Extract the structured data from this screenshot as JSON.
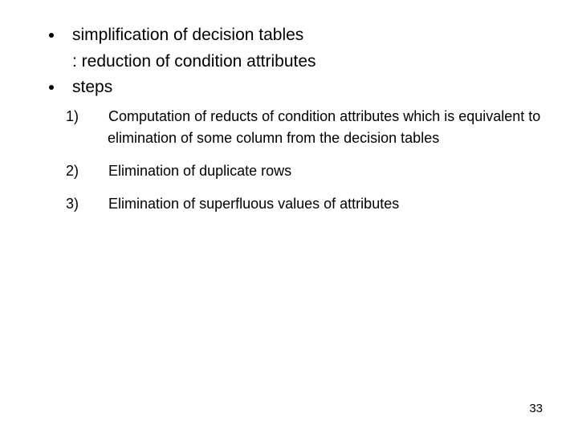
{
  "bullets": [
    {
      "text": "simplification of decision tables",
      "subtext": ": reduction of condition attributes"
    },
    {
      "text": "steps"
    }
  ],
  "steps": [
    {
      "n": "1)",
      "text": "Computation of reducts of condition attributes which is equivalent to elimination of some column from the decision tables"
    },
    {
      "n": "2)",
      "text": "Elimination of duplicate rows"
    },
    {
      "n": "3)",
      "text": "Elimination of superfluous values of attributes"
    }
  ],
  "page": "33"
}
